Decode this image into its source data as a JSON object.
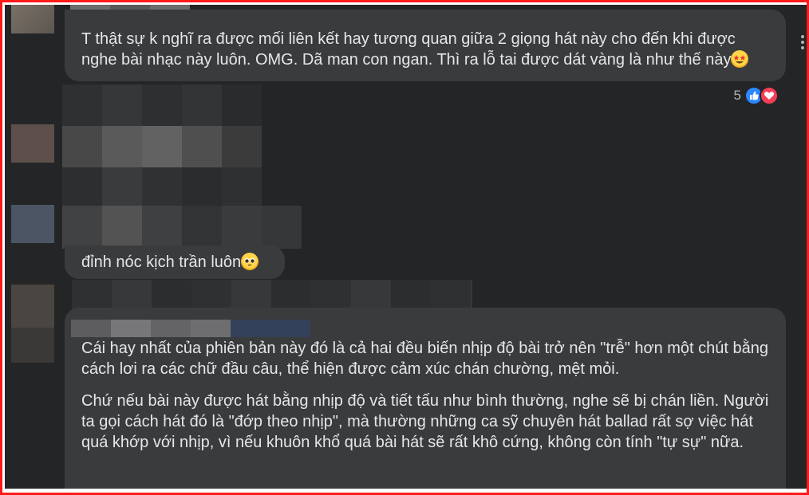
{
  "comments": [
    {
      "text": "T thật sự k nghĩ ra được mối liên kết hay tương quan giữa 2 giọng hát này cho đến khi được nghe bài nhạc này luôn. OMG. Dã man con ngan. Thì ra lỗ tai được dát vàng là như thế này",
      "emoji": "star-struck-emoji",
      "reaction_count": "5",
      "reactions": [
        "like-icon",
        "love-icon"
      ]
    },
    {
      "text": "đỉnh nóc kịch trần luôn",
      "emoji": "pleading-face-emoji"
    },
    {
      "paragraphs": [
        "Cái hay nhất của phiên bản này đó là cả hai đều biến nhịp độ bài trở nên \"trễ\" hơn một chút bằng cách lơi ra các chữ đầu câu, thể hiện được cảm xúc chán chường, mệt mỏi.",
        "Chứ nếu bài này được hát bằng nhịp độ và tiết tấu như bình thường, nghe sẽ bị chán liền. Người ta gọi cách hát đó là \"đớp theo nhịp\", mà thường những ca sỹ chuyên hát ballad rất sợ việc hát quá khớp với nhịp, vì nếu khuôn khổ quá bài hát sẽ rất khô cứng, không còn tính \"tự sự\" nữa."
      ]
    }
  ],
  "colors": {
    "frame": "#ff1a1a",
    "background": "#242526",
    "bubble": "#3a3b3c",
    "text": "#e4e6eb",
    "muted": "#b0b3b8",
    "like": "#2d88ff",
    "love": "#f33e58"
  }
}
